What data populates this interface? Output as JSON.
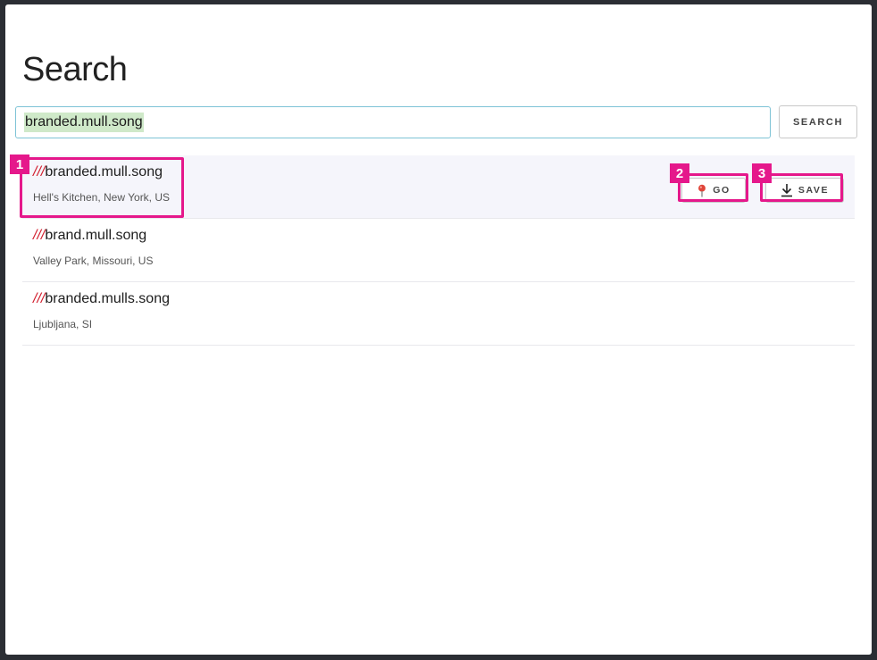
{
  "dialog": {
    "title": "Search"
  },
  "search": {
    "value": "branded.mull.song",
    "button_label": "SEARCH"
  },
  "results": [
    {
      "slashes": "///",
      "words": "branded.mull.song",
      "location": "Hell's Kitchen, New York, US"
    },
    {
      "slashes": "///",
      "words": "brand.mull.song",
      "location": "Valley Park, Missouri, US"
    },
    {
      "slashes": "///",
      "words": "branded.mulls.song",
      "location": "Ljubljana, SI"
    }
  ],
  "actions": {
    "go_label": "GO",
    "save_label": "SAVE"
  },
  "annotations": {
    "badge_1": "1",
    "badge_2": "2",
    "badge_3": "3"
  },
  "colors": {
    "highlight": "#e5188b",
    "slashes": "#d11a2a",
    "input_border": "#7ec3d6",
    "selection": "#cfe9c9"
  },
  "icons": {
    "go": "map-pin-icon",
    "save": "download-icon"
  }
}
